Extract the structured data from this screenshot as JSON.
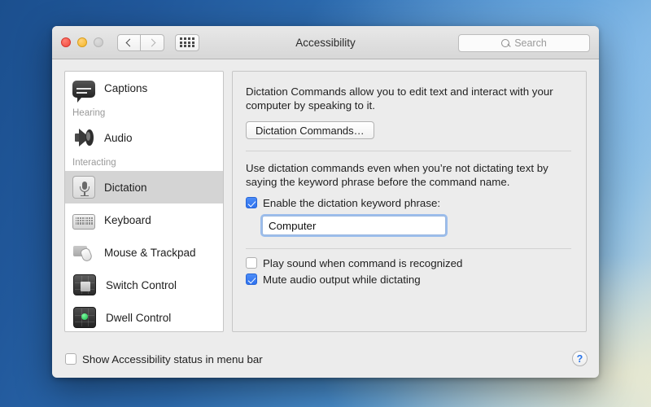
{
  "window": {
    "title": "Accessibility",
    "traffic_lights": [
      "close-red",
      "minimize-yellow",
      "zoom-disabled"
    ],
    "nav": {
      "back_icon": "chevron-left-icon",
      "forward_icon": "chevron-right-icon"
    },
    "show_all_icon": "grid-dots-icon",
    "search": {
      "placeholder": "Search",
      "value": "",
      "icon": "search-icon"
    }
  },
  "sidebar": {
    "items": [
      {
        "type": "item",
        "label": "Captions",
        "icon": "captions-icon",
        "selected": false
      },
      {
        "type": "group",
        "label": "Hearing"
      },
      {
        "type": "item",
        "label": "Audio",
        "icon": "audio-icon",
        "selected": false
      },
      {
        "type": "group",
        "label": "Interacting"
      },
      {
        "type": "item",
        "label": "Dictation",
        "icon": "dictation-icon",
        "selected": true
      },
      {
        "type": "item",
        "label": "Keyboard",
        "icon": "keyboard-icon",
        "selected": false
      },
      {
        "type": "item",
        "label": "Mouse & Trackpad",
        "icon": "mouse-icon",
        "selected": false
      },
      {
        "type": "item",
        "label": "Switch Control",
        "icon": "switch-icon",
        "selected": false
      },
      {
        "type": "item",
        "label": "Dwell Control",
        "icon": "dwell-icon",
        "selected": false
      }
    ]
  },
  "panel": {
    "intro": "Dictation Commands allow you to edit text and interact with your computer by speaking to it.",
    "commands_button": "Dictation Commands…",
    "keyword_description": "Use dictation commands even when you’re not dictating text by saying the keyword phrase before the command name.",
    "enable_keyword": {
      "label": "Enable the dictation keyword phrase:",
      "checked": true
    },
    "keyword_input": {
      "value": "Computer",
      "placeholder": ""
    },
    "play_sound": {
      "label": "Play sound when command is recognized",
      "checked": false
    },
    "mute_audio": {
      "label": "Mute audio output while dictating",
      "checked": true
    }
  },
  "footer": {
    "show_status": {
      "label": "Show Accessibility status in menu bar",
      "checked": false
    },
    "help_label": "?"
  },
  "colors": {
    "accent_blue": "#2f72ef",
    "focus_ring": "#5998ed",
    "selected_row": "#d4d4d4",
    "help_blue": "#2a74e8"
  }
}
